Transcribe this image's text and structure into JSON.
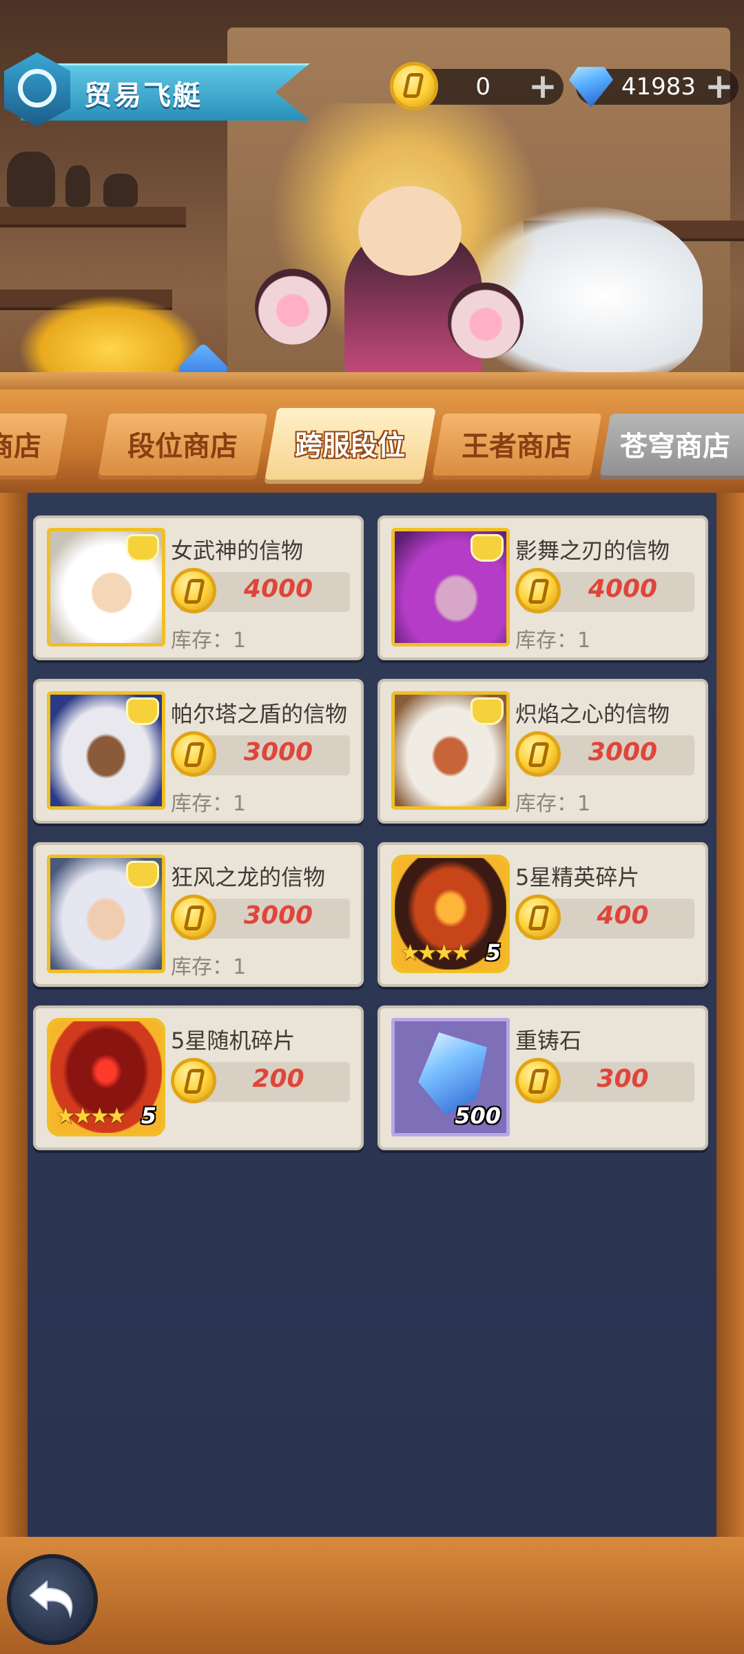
{
  "header": {
    "title": "贸易飞艇",
    "gold": {
      "icon": "gold-coin-icon",
      "value": "0"
    },
    "gems": {
      "icon": "diamond-icon",
      "value": "41983"
    }
  },
  "tabs": [
    {
      "label": "镜商店",
      "state": "normal"
    },
    {
      "label": "段位商店",
      "state": "normal"
    },
    {
      "label": "跨服段位",
      "state": "active"
    },
    {
      "label": "王者商店",
      "state": "normal"
    },
    {
      "label": "苍穹商店",
      "state": "disabled"
    }
  ],
  "items": [
    {
      "name": "女武神的信物",
      "price": "4000",
      "stock": "库存：1",
      "icon": "white-hooded-hero-portrait"
    },
    {
      "name": "影舞之刃的信物",
      "price": "4000",
      "stock": "库存：1",
      "icon": "purple-elf-hero-portrait"
    },
    {
      "name": "帕尔塔之盾的信物",
      "price": "3000",
      "stock": "库存：1",
      "icon": "silver-hair-hero-portrait"
    },
    {
      "name": "炽焰之心的信物",
      "price": "3000",
      "stock": "库存：1",
      "icon": "horned-beast-hero-portrait"
    },
    {
      "name": "狂风之龙的信物",
      "price": "3000",
      "stock": "库存：1",
      "icon": "white-hair-hero-portrait"
    },
    {
      "name": "5星精英碎片",
      "price": "400",
      "stars": "★★★★",
      "star_count": "5",
      "icon": "elite-shard-mask-icon"
    },
    {
      "name": "5星随机碎片",
      "price": "200",
      "stars": "★★★★",
      "star_count": "5",
      "icon": "random-shard-mask-icon"
    },
    {
      "name": "重铸石",
      "price": "300",
      "quantity": "500",
      "icon": "reforge-stone-icon"
    }
  ],
  "colors": {
    "price_red": "#e0453a",
    "gold_border": "#f1bf24",
    "panel_bg": "#2f3a57",
    "tab_orange": "#d98a3e"
  }
}
